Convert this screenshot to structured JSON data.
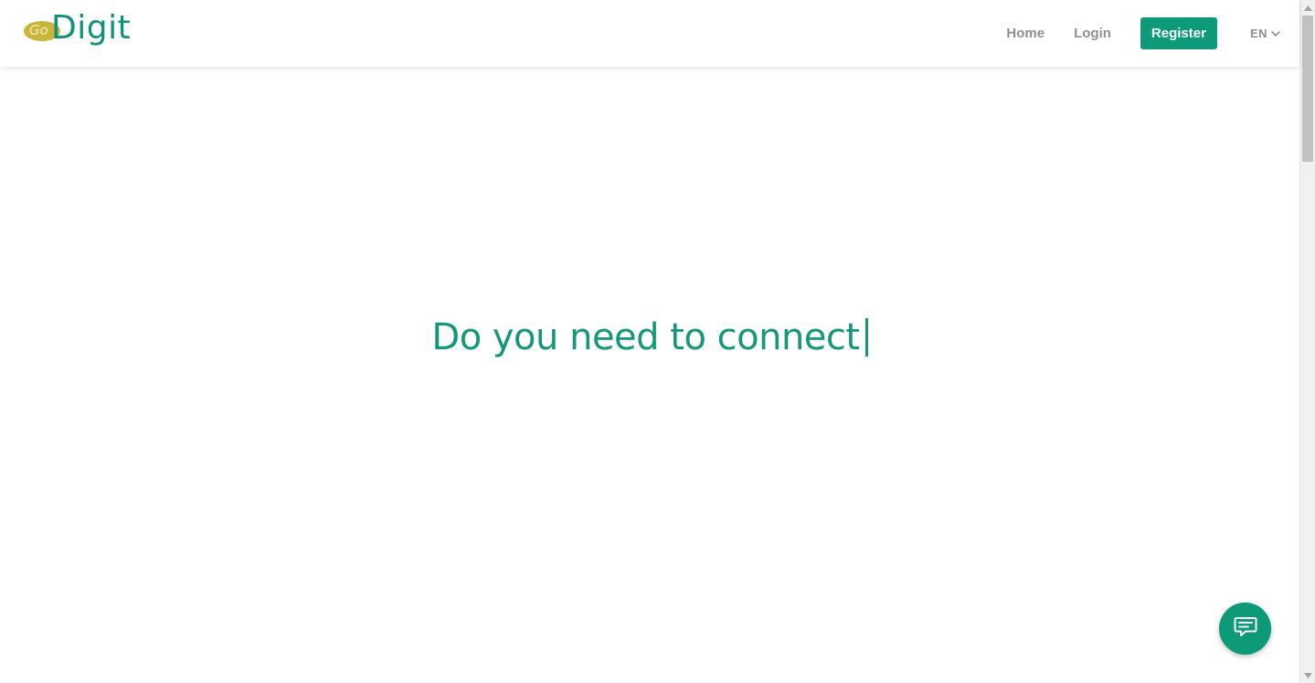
{
  "brand": {
    "logo_go": "Go",
    "logo_name": "Digit",
    "primary_color": "#0d9a79",
    "accent_color": "#c9b53a"
  },
  "nav": {
    "home_label": "Home",
    "login_label": "Login",
    "register_label": "Register",
    "language": "EN",
    "language_icon": "chevron-down-icon"
  },
  "hero": {
    "text": "Do you need to connect"
  },
  "chat": {
    "icon": "chat-bubble-icon"
  }
}
